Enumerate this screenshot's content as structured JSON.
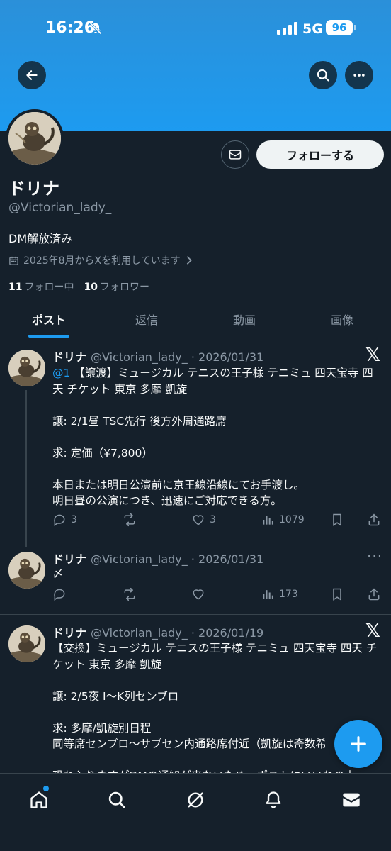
{
  "status": {
    "time": "16:26",
    "network": "5G",
    "battery": "96"
  },
  "profile": {
    "name": "ドリナ",
    "handle": "@Victorian_lady_",
    "bio": "DM解放済み",
    "joined": "2025年8月からXを利用しています",
    "following_count": "11",
    "following_label": "フォロー中",
    "followers_count": "10",
    "followers_label": "フォロワー",
    "follow_label": "フォローする"
  },
  "tabs": [
    "ポスト",
    "返信",
    "動画",
    "画像"
  ],
  "posts": [
    {
      "name": "ドリナ",
      "meta": "@Victorian_lady_ · 2026/01/31",
      "mention": "@1",
      "body_first": " 【譲渡】ミュージカル テニスの王子様 テニミュ 四天宝寺 四天 チケット 東京 多摩 凱旋",
      "body_rest": "譲: 2/1昼 TSC先行 後方外周通路席\n\n求: 定価（¥7,800）\n\n本日または明日公演前に京王線沿線にてお手渡し。\n明日昼の公演につき、迅速にご対応できる方。",
      "replies": "3",
      "reposts": "",
      "likes": "3",
      "views": "1079"
    },
    {
      "name": "ドリナ",
      "meta": "@Victorian_lady_ · 2026/01/31",
      "body": "〆",
      "replies": "",
      "reposts": "",
      "likes": "",
      "views": "173"
    },
    {
      "name": "ドリナ",
      "meta": "@Victorian_lady_ · 2026/01/19",
      "body": "【交換】ミュージカル テニスの王子様 テニミュ 四天宝寺 四天 チケット 東京 多摩 凱旋\n\n譲: 2/5夜 I〜K列センブロ\n\n求: 多摩/凱旋別日程\n同等席センブロ〜サブセン内通路席付近（凱旋は奇数希\n\n恐れ入りますがDMの通知が来ないため、ポストにいいねの上"
    }
  ],
  "colors": {
    "accent": "#1d9bf0",
    "background": "#15202b",
    "muted": "#8b98a5"
  }
}
